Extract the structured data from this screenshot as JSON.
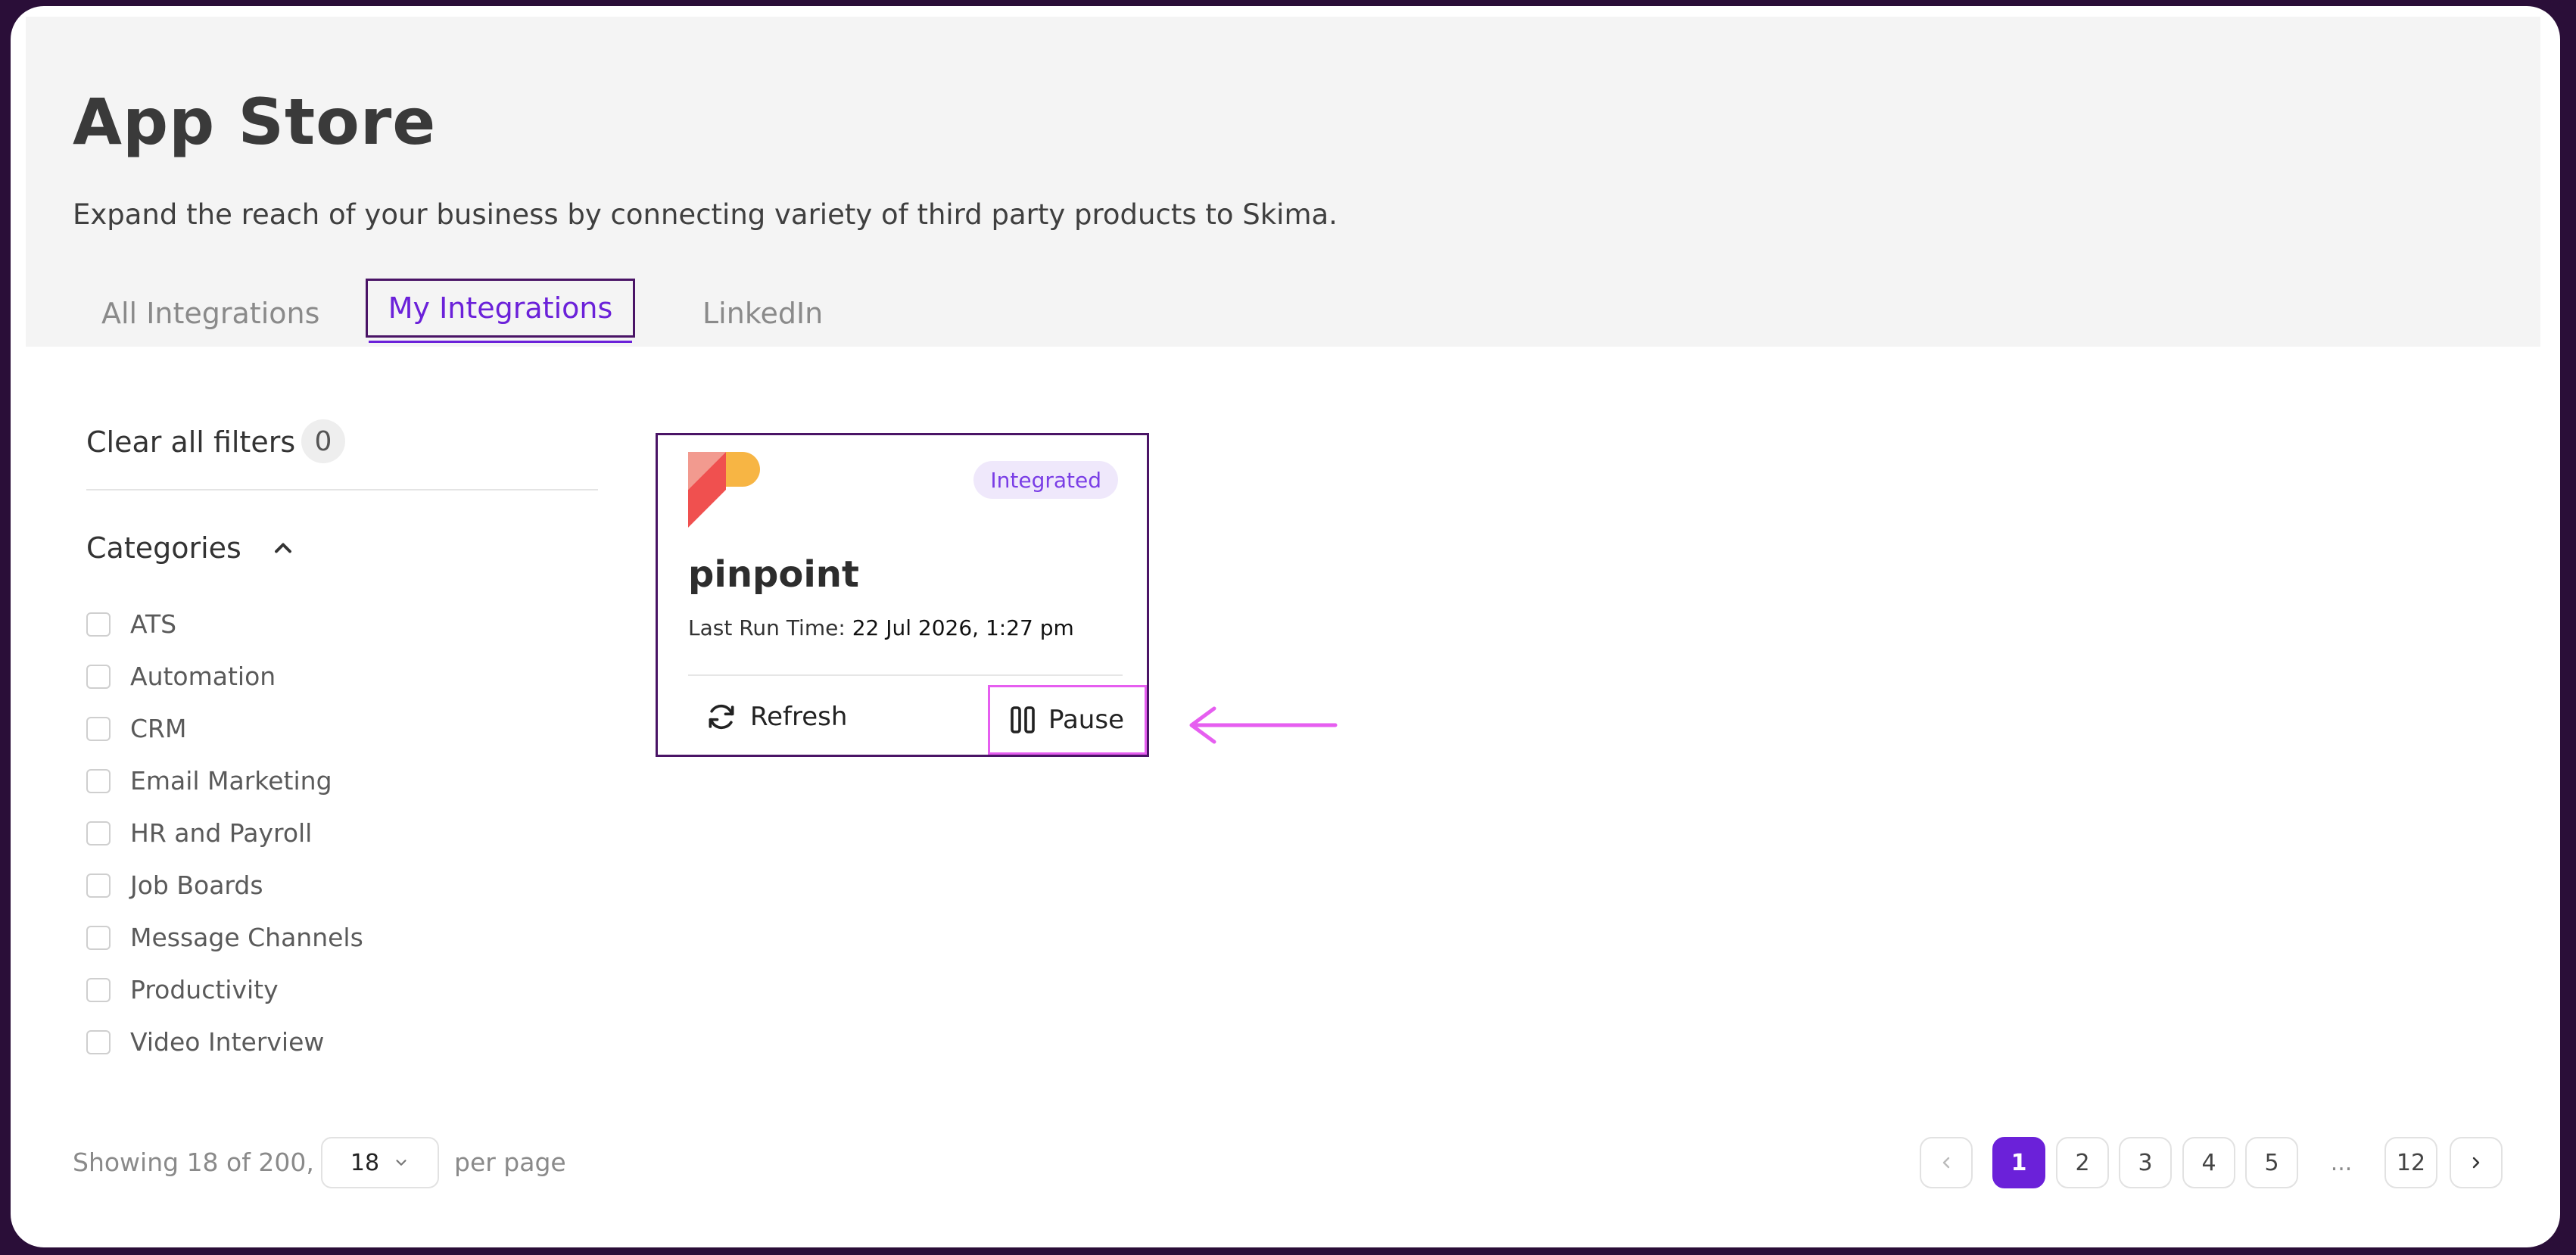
{
  "header": {
    "title": "App Store",
    "subtitle": "Expand the reach of your business by connecting variety of third party products to Skima."
  },
  "tabs": [
    {
      "label": "All Integrations",
      "active": false
    },
    {
      "label": "My Integrations",
      "active": true
    },
    {
      "label": "LinkedIn",
      "active": false
    }
  ],
  "filters": {
    "clear_label": "Clear all filters",
    "count": "0",
    "categories_title": "Categories",
    "categories": [
      "ATS",
      "Automation",
      "CRM",
      "Email Marketing",
      "HR and Payroll",
      "Job Boards",
      "Message Channels",
      "Productivity",
      "Video Interview"
    ]
  },
  "card": {
    "name": "pinpoint",
    "badge": "Integrated",
    "last_run_label": "Last Run Time:",
    "last_run_value": "22 Jul 2026, 1:27 pm",
    "refresh_label": "Refresh",
    "pause_label": "Pause",
    "logo_colors": {
      "red": "#f0504f",
      "pink": "#f29a8f",
      "yellow": "#f7b544"
    }
  },
  "footer": {
    "showing_text": "Showing 18 of 200,",
    "per_page_value": "18",
    "per_page_label": "per page",
    "pages": [
      "1",
      "2",
      "3",
      "4",
      "5"
    ],
    "ellipsis": "...",
    "last_page": "12",
    "current_page": "1"
  },
  "colors": {
    "accent": "#6b21d9",
    "tab_outline": "#4a1466",
    "annotation": "#e65ef0"
  }
}
